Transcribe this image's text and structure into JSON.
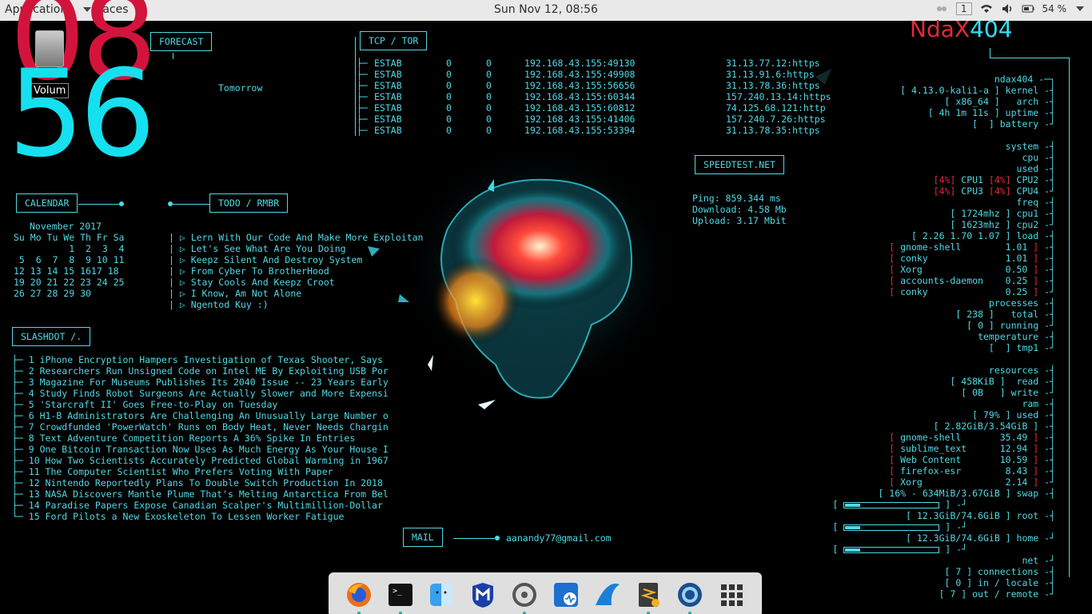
{
  "topbar": {
    "applications": "Applications",
    "places": "Places",
    "clock": "Sun Nov 12, 08:56",
    "workspace": "1",
    "battery": "54 %"
  },
  "desktop": {
    "drive_label": "Volum",
    "hour": "08",
    "minute": "56"
  },
  "forecast": {
    "title": "FORECAST",
    "tomorrow": "Tomorrow"
  },
  "tcp": {
    "title": "TCP / TOR",
    "rows": [
      [
        "ESTAB",
        "0",
        "0",
        "192.168.43.155:49130",
        "31.13.77.12:https"
      ],
      [
        "ESTAB",
        "0",
        "0",
        "192.168.43.155:49908",
        "31.13.91.6:https"
      ],
      [
        "ESTAB",
        "0",
        "0",
        "192.168.43.155:56656",
        "31.13.78.36:https"
      ],
      [
        "ESTAB",
        "0",
        "0",
        "192.168.43.155:60344",
        "157.240.13.14:https"
      ],
      [
        "ESTAB",
        "0",
        "0",
        "192.168.43.155:60812",
        "74.125.68.121:http"
      ],
      [
        "ESTAB",
        "0",
        "0",
        "192.168.43.155:41406",
        "157.240.7.26:https"
      ],
      [
        "ESTAB",
        "0",
        "0",
        "192.168.43.155:53394",
        "31.13.78.35:https"
      ]
    ]
  },
  "speedtest": {
    "title": "SPEEDTEST.NET",
    "ping": "Ping: 859.344 ms",
    "download": "Download: 4.58 Mb",
    "upload": "Upload: 3.17 Mbit"
  },
  "calendar": {
    "title": "CALENDAR",
    "month": "November 2017",
    "lines": [
      "Su Mo Tu We Th Fr Sa",
      "          1  2  3  4",
      " 5  6  7  8  9 10 11",
      "12 13 14 15 1617 18",
      "19 20 21 22 23 24 25",
      "26 27 28 29 30"
    ]
  },
  "todo": {
    "title": "TODO / RMBR",
    "items": [
      "| ▷ Lern With Our Code And Make More Exploitan",
      "| ▷ Let's See What Are You Doing",
      "| ▷ Keepz Silent And Destroy System",
      "| ▷ From Cyber To BrotherHood",
      "| ▷ Stay Cools And Keepz Croot",
      "| ▷ I Know, Am Not Alone",
      "| ▷ Ngentod Kuy :)"
    ]
  },
  "slashdot": {
    "title": "SLASHDOT /.",
    "items": [
      "├─ 1 iPhone Encryption Hampers Investigation of Texas Shooter, Says",
      "├─ 2 Researchers Run Unsigned Code on Intel ME By Exploiting USB Por",
      "├─ 3 Magazine For Museums Publishes Its 2040 Issue -- 23 Years Early",
      "├─ 4 Study Finds Robot Surgeons Are Actually Slower and More Expensi",
      "├─ 5 'Starcraft II' Goes Free-to-Play on Tuesday",
      "├─ 6 H1-B Administrators Are Challenging An Unusually Large Number o",
      "├─ 7 Crowdfunded 'PowerWatch' Runs on Body Heat, Never Needs Chargin",
      "├─ 8 Text Adventure Competition Reports A 36% Spike In Entries",
      "├─ 9 One Bitcoin Transaction Now Uses As Much Energy As Your House I",
      "├─ 10 How Two Scientists Accurately Predicted Global Warming in 1967",
      "├─ 11 The Computer Scientist Who Prefers Voting With Paper",
      "├─ 12 Nintendo Reportedly Plans To Double Switch Production In 2018",
      "├─ 13 NASA Discovers Mantle Plume That's Melting Antarctica From Bel",
      "├─ 14 Paradise Papers Expose Canadian Scalper's Multimillion-Dollar",
      "└─ 15 Ford Pilots a New Exoskeleton To Lessen Worker Fatigue"
    ]
  },
  "mail": {
    "title": "MAIL",
    "address": "aanandy77@gmail.com"
  },
  "system": {
    "logo_a": "NdaX",
    "logo_b": "404",
    "rows": [
      {
        "t": "ndax404 -─┐",
        "red": false
      },
      {
        "t": "[ 4.13.0-kali1-a ] kernel -┤",
        "red": false
      },
      {
        "t": "[ x86_64 ]   arch -┤",
        "red": false
      },
      {
        "t": "[ 4h 1m 11s ] uptime -┤",
        "red": false
      },
      {
        "t": "[  ] battery -┘",
        "red": false
      },
      {
        "t": "",
        "red": false
      },
      {
        "t": "system -┤",
        "red": false
      },
      {
        "t": "cpu -┤",
        "red": false
      },
      {
        "t": "used -┤",
        "red": false
      },
      {
        "t": "[4%] CPU1 [4%] CPU2 -┤",
        "red": true
      },
      {
        "t": "[4%] CPU3 [4%] CPU4 -┘",
        "red": true
      },
      {
        "t": "freq -┤",
        "red": false
      },
      {
        "t": "[ 1724mhz ] cpu1 -┤",
        "red": false
      },
      {
        "t": "[ 1623mhz ] cpu2 -┘",
        "red": false
      },
      {
        "t": "[ 2.26 1.70 1.07 ] load -┤",
        "red": false
      },
      {
        "t": "[ gnome-shell        1.01 ] -┤",
        "red": true
      },
      {
        "t": "[ conky              1.01 ] -┤",
        "red": true
      },
      {
        "t": "[ Xorg               0.50 ] -┤",
        "red": true
      },
      {
        "t": "[ accounts-daemon    0.25 ] -┤",
        "red": true
      },
      {
        "t": "[ conky              0.25 ] -┘",
        "red": true
      },
      {
        "t": "processes -┤",
        "red": false
      },
      {
        "t": "[ 238 ]   total -┤",
        "red": false
      },
      {
        "t": "[ 0 ] running -┘",
        "red": false
      },
      {
        "t": "temperature -┤",
        "red": false
      },
      {
        "t": "[  ] tmp1 -┘",
        "red": false
      },
      {
        "t": "",
        "red": false
      },
      {
        "t": "resources -┤",
        "red": false
      },
      {
        "t": "[ 458KiB ]  read -┤",
        "red": false
      },
      {
        "t": "[ 0B   ] write -┘",
        "red": false
      },
      {
        "t": "ram -┤",
        "red": false
      },
      {
        "t": "[ 79% ] used -┤",
        "red": false
      },
      {
        "t": "[ 2.82GiB/3.54GiB ] -┤",
        "red": false
      },
      {
        "t": "[ gnome-shell       35.49 ] -┤",
        "red": true
      },
      {
        "t": "[ sublime_text      12.94 ] -┤",
        "red": true
      },
      {
        "t": "[ Web Content       10.59 ] -┤",
        "red": true
      },
      {
        "t": "[ firefox-esr        8.43 ] -┤",
        "red": true
      },
      {
        "t": "[ Xorg               2.14 ] -┘",
        "red": true
      },
      {
        "t": "[ 16% - 634MiB/3.67GiB ] swap -┤",
        "red": false
      },
      {
        "t": "",
        "red": false
      },
      {
        "t": "[ 12.3GiB/74.6GiB ] root -┤",
        "red": false
      },
      {
        "t": "",
        "red": false
      },
      {
        "t": "[ 12.3GiB/74.6GiB ] home -┘",
        "red": false
      },
      {
        "t": "",
        "red": false
      },
      {
        "t": "net -┘",
        "red": false
      },
      {
        "t": "[ 7 ] connections -┤",
        "red": false
      },
      {
        "t": "[ 0 ] in / locale -┤",
        "red": false
      },
      {
        "t": "[ 7 ] out / remote -┘",
        "red": false
      }
    ],
    "swap_fill": 0.16,
    "root_fill": 0.16,
    "home_fill": 0.16
  },
  "dock": {
    "items": [
      "firefox-icon",
      "terminal-icon",
      "finder-icon",
      "metasploit-icon",
      "settings-icon",
      "app-store-icon",
      "wireshark-icon",
      "sublime-text-icon",
      "quicktime-icon",
      "app-grid-icon"
    ]
  }
}
